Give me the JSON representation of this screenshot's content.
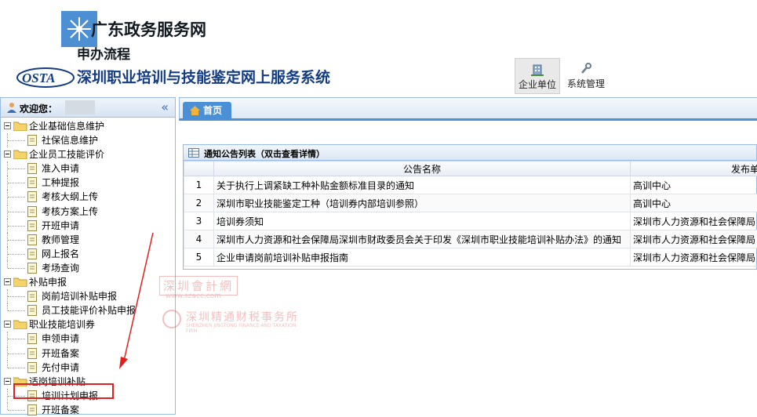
{
  "header": {
    "portal_title": "广东政务服务网",
    "portal_subtitle": "申办流程",
    "osta_logo_text": "OSTA",
    "system_title": "深圳职业培训与技能鉴定网上服务系统",
    "nav": [
      {
        "label": "企业单位",
        "icon": "building-icon",
        "active": true
      },
      {
        "label": "系统管理",
        "icon": "wrench-icon",
        "active": false
      }
    ]
  },
  "sidebar": {
    "welcome": "欢迎您：",
    "collapse_glyph": "«",
    "groups": [
      {
        "label": "企业基础信息维护",
        "items": [
          "社保信息维护"
        ]
      },
      {
        "label": "企业员工技能评价",
        "items": [
          "准入申请",
          "工种提报",
          "考核大纲上传",
          "考核方案上传",
          "开班申请",
          "教师管理",
          "网上报名",
          "考场查询"
        ]
      },
      {
        "label": "补贴申报",
        "items": [
          "岗前培训补贴申报",
          "员工技能评价补贴申报"
        ]
      },
      {
        "label": "职业技能培训券",
        "items": [
          "申领申请",
          "开班备案",
          "先付申请"
        ]
      },
      {
        "label": "适岗培训补贴",
        "items": [
          "培训计划申报",
          "开班备案"
        ]
      }
    ]
  },
  "tabs": [
    {
      "label": "首页",
      "icon": "home-icon"
    }
  ],
  "notice": {
    "title": "通知公告列表（双击查看详情）",
    "columns": [
      "",
      "公告名称",
      "发布单位"
    ],
    "rows": [
      {
        "no": "1",
        "name": "关于执行上调紧缺工种补贴金额标准目录的通知",
        "publisher": "高训中心"
      },
      {
        "no": "2",
        "name": "深圳市职业技能鉴定工种（培训券内部培训参照）",
        "publisher": "高训中心"
      },
      {
        "no": "3",
        "name": "培训券须知",
        "publisher": "深圳市人力资源和社会保障局"
      },
      {
        "no": "4",
        "name": "深圳市人力资源和社会保障局深圳市财政委员会关于印发《深圳市职业技能培训补贴办法》的通知",
        "publisher": "深圳市人力资源和社会保障局"
      },
      {
        "no": "5",
        "name": "企业申请岗前培训补贴申报指南",
        "publisher": "深圳市人力资源和社会保障局"
      }
    ]
  },
  "watermark": {
    "line1": "深圳會計網",
    "line2": "www.szacc.com",
    "line3": "深圳精通财税事务所",
    "line4": "SHENZHEN JINGTONG FINANCE AND TAXATION FIRM"
  },
  "colors": {
    "accent": "#4b8fd6",
    "border": "#99bbe8",
    "highlight": "#e02020"
  }
}
